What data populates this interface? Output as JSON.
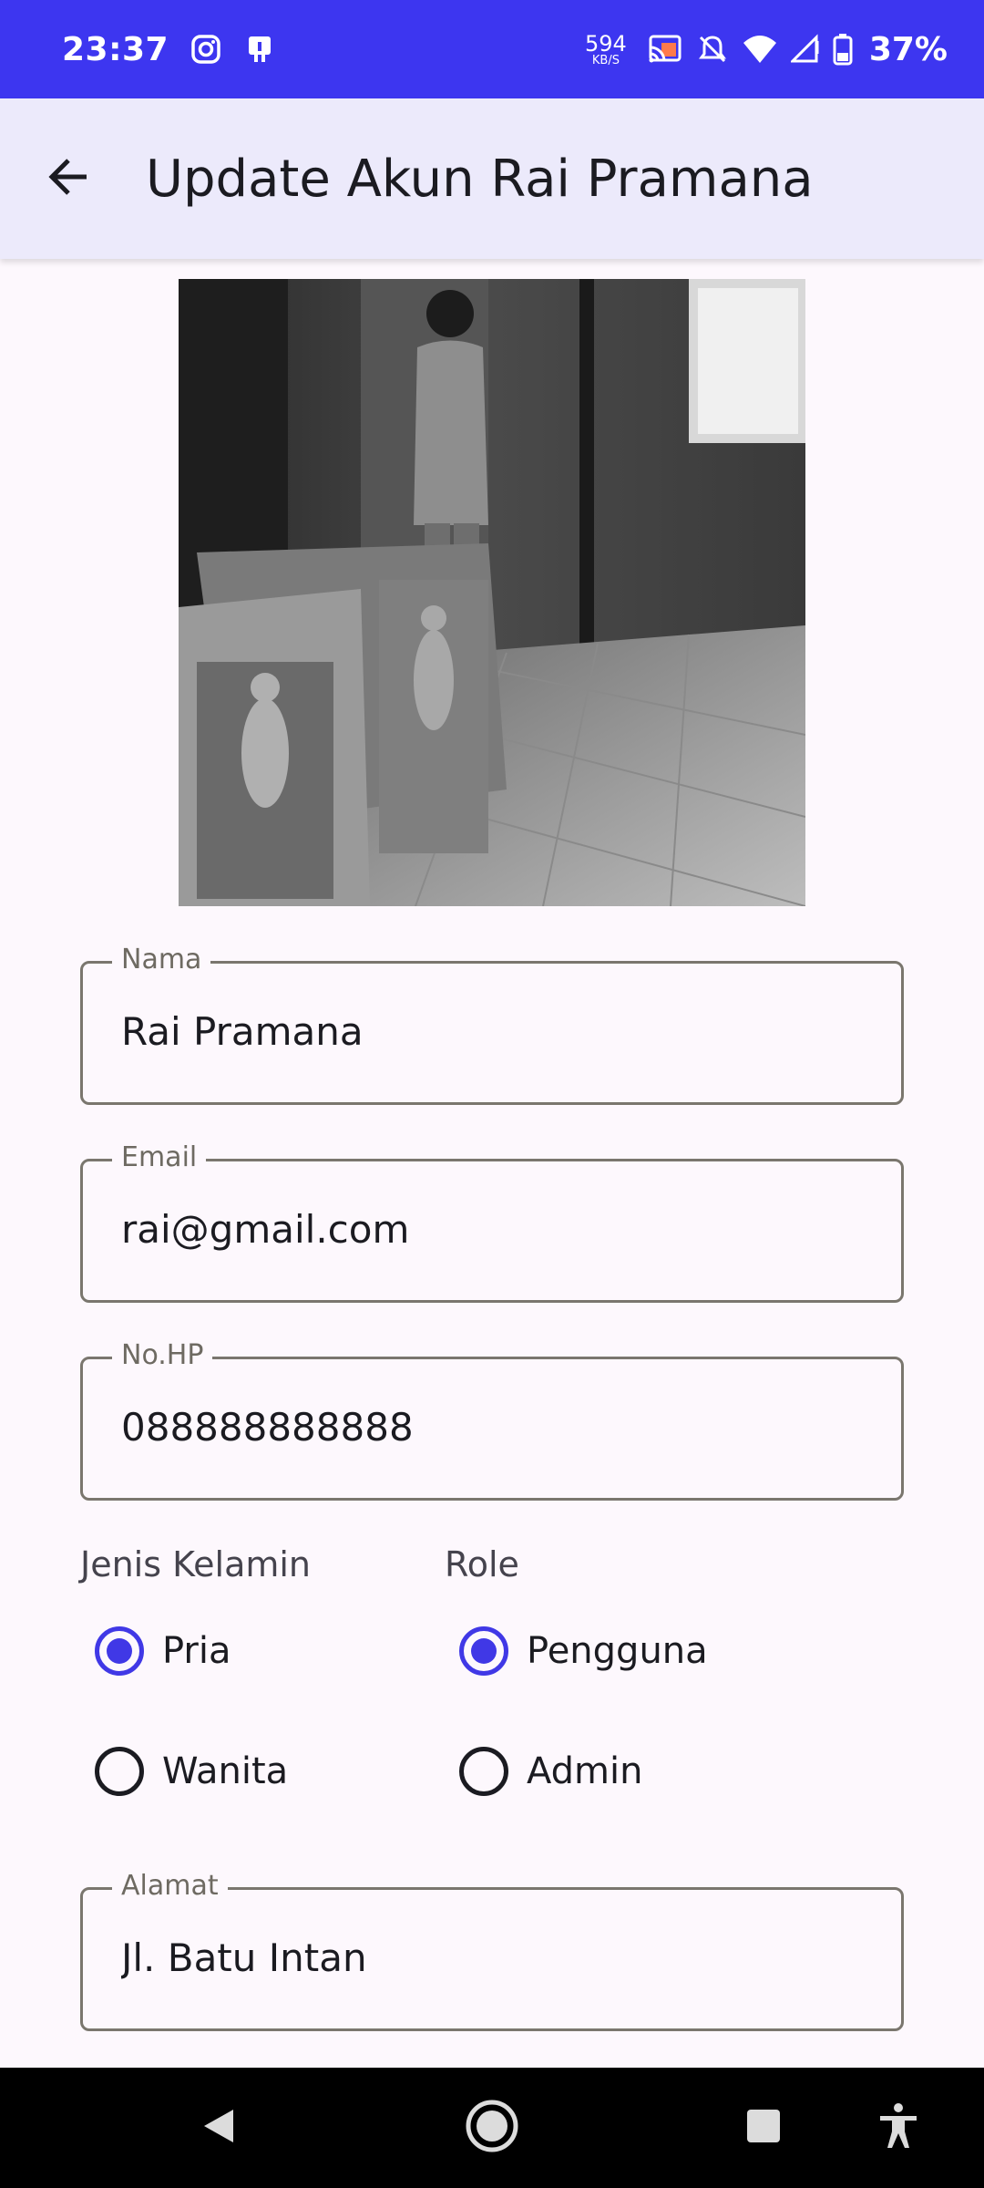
{
  "status_bar": {
    "time": "23:37",
    "net_speed_value": "594",
    "net_speed_unit": "KB/S",
    "battery": "37%",
    "icons": [
      "instagram-icon",
      "app-notification-icon",
      "cast-icon",
      "mute-icon",
      "wifi-icon",
      "signal-icon",
      "battery-icon"
    ]
  },
  "app_bar": {
    "title": "Update Akun Rai Pramana",
    "back_icon": "arrow-back-icon"
  },
  "profile_photo": {
    "type": "photo",
    "icon": "profile-photo"
  },
  "form": {
    "nama": {
      "label": "Nama",
      "value": "Rai Pramana"
    },
    "email": {
      "label": "Email",
      "value": "rai@gmail.com"
    },
    "phone": {
      "label": "No.HP",
      "value": "088888888888"
    },
    "alamat": {
      "label": "Alamat",
      "value": "Jl. Batu Intan"
    },
    "gender": {
      "title": "Jenis Kelamin",
      "options": [
        {
          "label": "Pria",
          "selected": true
        },
        {
          "label": "Wanita",
          "selected": false
        }
      ]
    },
    "role": {
      "title": "Role",
      "options": [
        {
          "label": "Pengguna",
          "selected": true
        },
        {
          "label": "Admin",
          "selected": false
        }
      ]
    }
  },
  "nav_bar": {
    "icons": [
      "back-triangle-icon",
      "home-circle-icon",
      "recents-square-icon",
      "accessibility-icon"
    ]
  },
  "colors": {
    "status_bar": "#3d36f0",
    "app_bar": "#eceafb",
    "accent": "#4038e6",
    "background": "#fdf8fd"
  }
}
